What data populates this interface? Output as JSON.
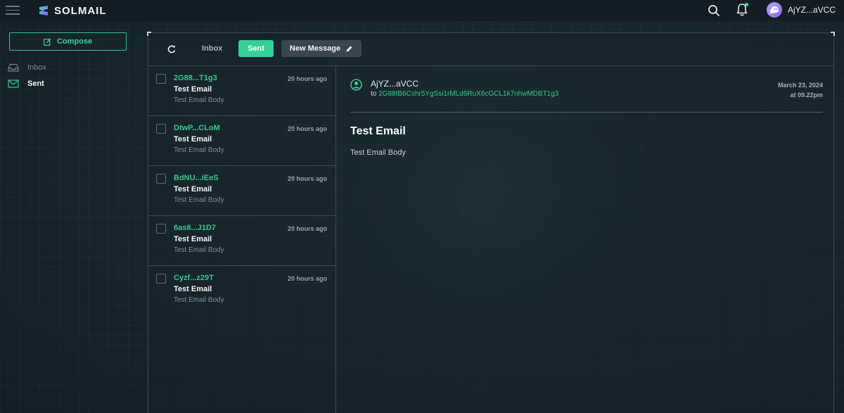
{
  "header": {
    "brand": "SOLMAIL",
    "user_name": "AjYZ...aVCC",
    "has_notification": true
  },
  "colors": {
    "accent": "#33d196",
    "accent_text": "#34c98f",
    "background": "#17222b"
  },
  "sidebar": {
    "compose_label": "Compose",
    "items": [
      {
        "label": "Inbox",
        "icon": "inbox-icon",
        "active": false
      },
      {
        "label": "Sent",
        "icon": "mail-icon",
        "active": true
      }
    ]
  },
  "toolbar": {
    "refresh_icon": "refresh-icon",
    "tabs": [
      {
        "label": "Inbox",
        "active": false
      },
      {
        "label": "Sent",
        "active": true
      }
    ],
    "new_message_label": "New Message"
  },
  "messages": [
    {
      "from": "2G88...T1g3",
      "time": "20 hours ago",
      "subject": "Test Email",
      "body": "Test Email Body"
    },
    {
      "from": "DtwP...CLoM",
      "time": "20 hours ago",
      "subject": "Test Email",
      "body": "Test Email Body"
    },
    {
      "from": "BdNU...iEeS",
      "time": "20 hours ago",
      "subject": "Test Email",
      "body": "Test Email Body"
    },
    {
      "from": "6as8...J1D7",
      "time": "20 hours ago",
      "subject": "Test Email",
      "body": "Test Email Body"
    },
    {
      "from": "Cyzf...z29T",
      "time": "20 hours ago",
      "subject": "Test Email",
      "body": "Test Email Body"
    }
  ],
  "reader": {
    "sender": "AjYZ...aVCC",
    "to_prefix": "to",
    "to_address": "2G88tB6Cshr5YgSsi1rMLd6RuX6cGCL1k7nhwMDBT1g3",
    "date": "March 23, 2024",
    "time": "at 09.22pm",
    "subject": "Test Email",
    "body": "Test Email Body"
  }
}
